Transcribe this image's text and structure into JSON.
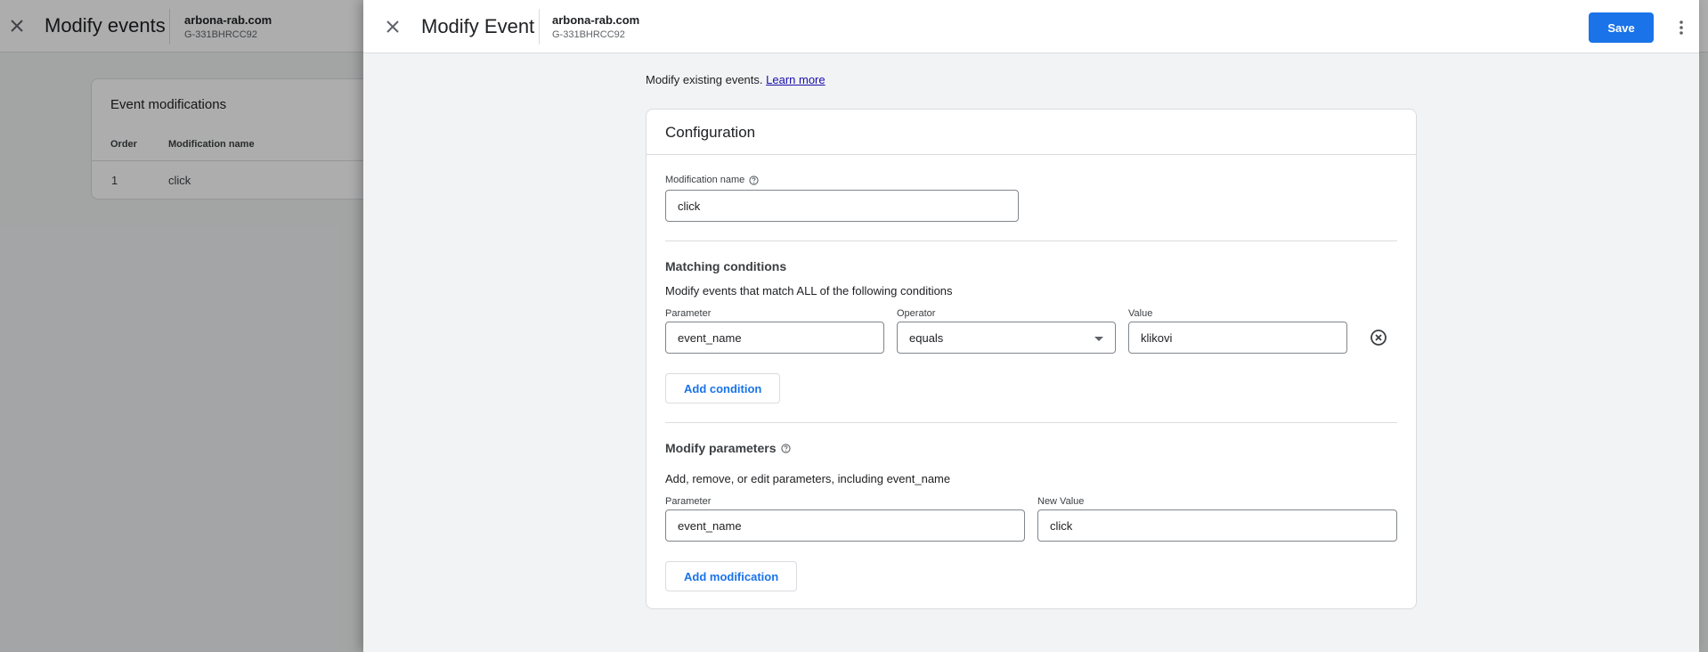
{
  "background": {
    "title": "Modify events",
    "property_name": "arbona-rab.com",
    "property_id": "G-331BHRCC92",
    "card_title": "Event modifications",
    "columns": [
      "Order",
      "Modification name"
    ],
    "rows": [
      {
        "order": "1",
        "name": "click"
      }
    ]
  },
  "drawer": {
    "title": "Modify Event",
    "property_name": "arbona-rab.com",
    "property_id": "G-331BHRCC92",
    "save_label": "Save",
    "intro_text": "Modify existing events.",
    "learn_more": "Learn more",
    "config": {
      "title": "Configuration",
      "modification_name_label": "Modification name",
      "modification_name_value": "click",
      "matching": {
        "title": "Matching conditions",
        "subtitle": "Modify events that match ALL of the following conditions",
        "parameter_label": "Parameter",
        "parameter_value": "event_name",
        "operator_label": "Operator",
        "operator_value": "equals",
        "value_label": "Value",
        "value_value": "klikovi",
        "add_condition_label": "Add condition"
      },
      "modify": {
        "title": "Modify parameters",
        "subtitle": "Add, remove, or edit parameters, including event_name",
        "parameter_label": "Parameter",
        "parameter_value": "event_name",
        "new_value_label": "New Value",
        "new_value_value": "click",
        "add_modification_label": "Add modification"
      }
    }
  },
  "colors": {
    "primary": "#1a73e8",
    "link": "#1a0dab",
    "border": "#dadce0",
    "scrim": "rgba(0,0,0,0.32)"
  },
  "icons": {
    "close": "close-icon",
    "more": "more-vert-icon",
    "help": "help-circle-icon",
    "dropdown": "arrow-drop-down-icon",
    "remove": "remove-circle-icon"
  }
}
